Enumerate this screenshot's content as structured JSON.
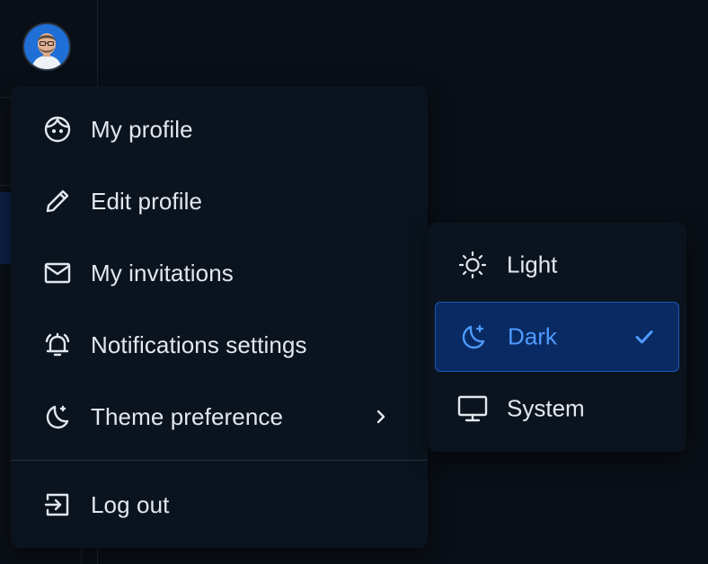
{
  "colors": {
    "background": "#0a0f17",
    "menu_bg": "#0b141e",
    "text": "#e3e7ee",
    "accent": "#4d9bff",
    "selected_bg": "#092a63",
    "avatar_bg": "#1f6fd6"
  },
  "user_menu": {
    "items": [
      {
        "label": "My profile",
        "icon": "face-icon"
      },
      {
        "label": "Edit profile",
        "icon": "pencil-icon"
      },
      {
        "label": "My invitations",
        "icon": "mail-icon"
      },
      {
        "label": "Notifications settings",
        "icon": "bell-icon"
      },
      {
        "label": "Theme preference",
        "icon": "moon-icon"
      }
    ],
    "logout_label": "Log out"
  },
  "theme_submenu": {
    "options": [
      {
        "label": "Light",
        "icon": "sun-icon",
        "selected": false
      },
      {
        "label": "Dark",
        "icon": "moon-star-icon",
        "selected": true
      },
      {
        "label": "System",
        "icon": "monitor-icon",
        "selected": false
      }
    ]
  }
}
